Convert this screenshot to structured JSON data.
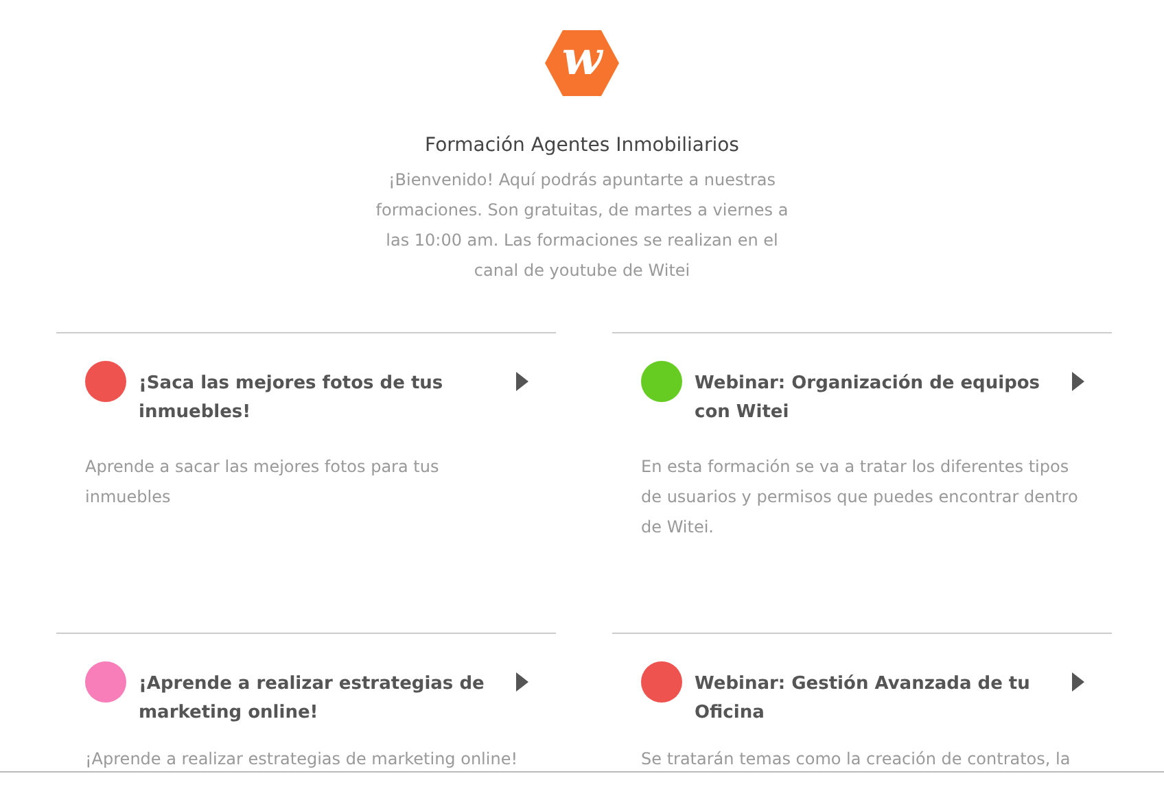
{
  "header": {
    "logo_letter": "w",
    "title": "Formación Agentes Inmobiliarios",
    "intro": "¡Bienvenido! Aquí podrás apuntarte a nuestras formaciones. Son gratuitas, de martes a viernes a las 10:00 am. Las formaciones se realizan en el canal de youtube de Witei"
  },
  "courses": [
    {
      "title": "¡Saca las mejores fotos de tus inmuebles!",
      "description": "Aprende a sacar las mejores fotos para tus inmuebles",
      "color": "#ef5350"
    },
    {
      "title": "Webinar: Organización de equipos con Witei",
      "description": "En esta formación se va a tratar los diferentes tipos de usuarios y permisos que puedes encontrar dentro de Witei.",
      "color": "#66cc22"
    },
    {
      "title": "¡Aprende a realizar estrategias de marketing online!",
      "description": "¡Aprende a realizar estrategias de marketing online!",
      "color": "#f77eb9"
    },
    {
      "title": "Webinar: Gestión Avanzada de tu Oficina",
      "description": "Se tratarán temas como la creación de contratos, la",
      "color": "#ef5350"
    }
  ]
}
